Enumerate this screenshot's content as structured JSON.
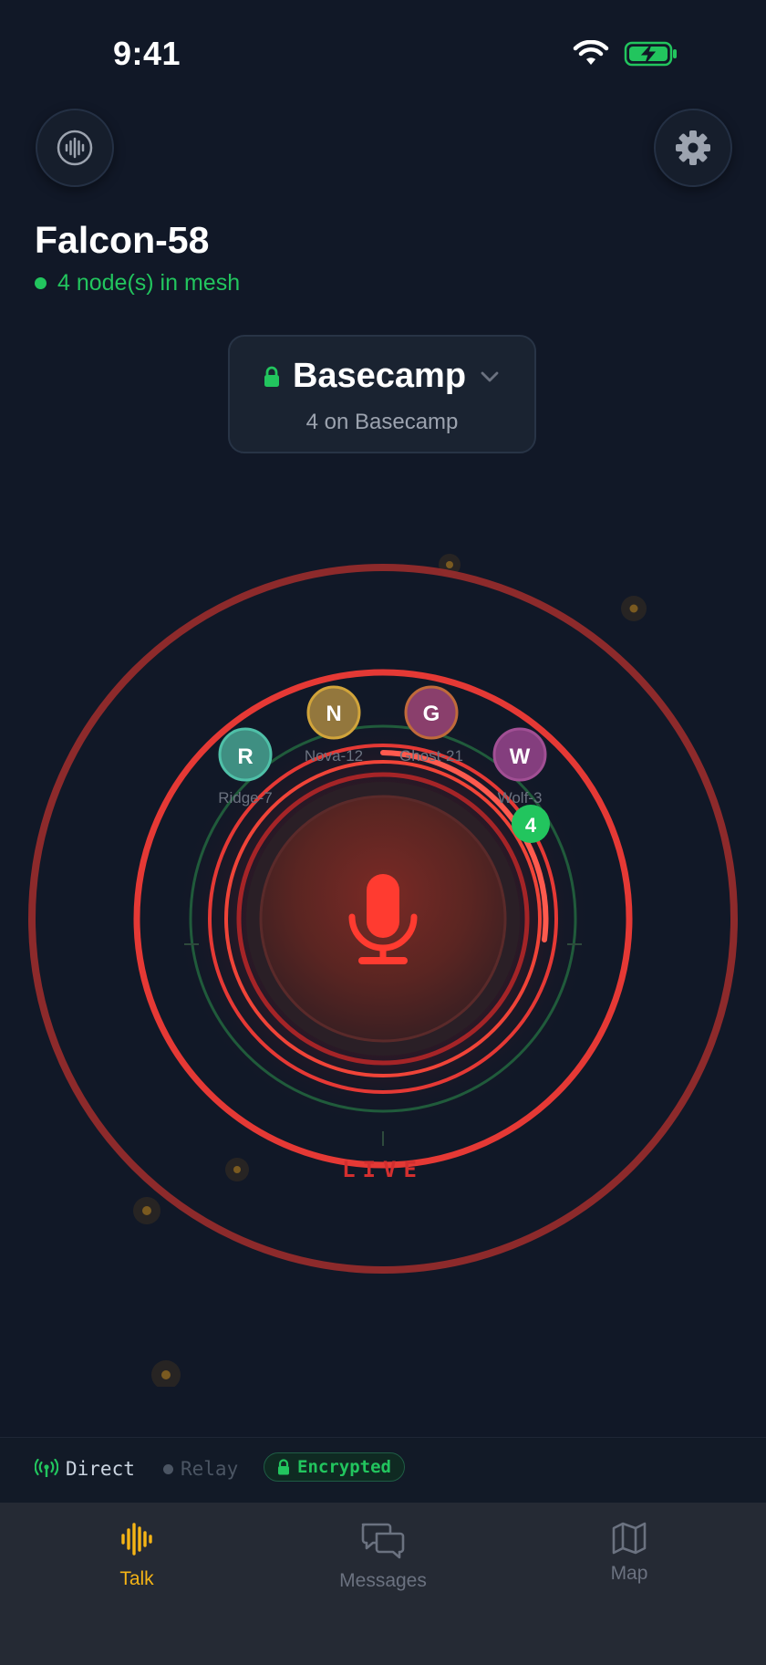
{
  "status_bar": {
    "time": "9:41"
  },
  "header": {
    "node_name": "Falcon-58",
    "mesh_status": "4 node(s) in mesh"
  },
  "channel": {
    "name": "Basecamp",
    "subtitle": "4 on Basecamp"
  },
  "talk_button": {
    "state_label": "LIVE",
    "peer_count_badge": "4",
    "peers": [
      {
        "initial": "R",
        "name": "Ridge-7",
        "color": "#3f9a8a"
      },
      {
        "initial": "N",
        "name": "Nova-12",
        "color": "#9b7a3a"
      },
      {
        "initial": "G",
        "name": "Ghost-21",
        "color": "#8f3f6f"
      },
      {
        "initial": "W",
        "name": "Wolf-3",
        "color": "#8a3f80"
      }
    ]
  },
  "link_modes": {
    "direct_label": "Direct",
    "relay_label": "Relay",
    "encryption_label": "Encrypted"
  },
  "tab_bar": {
    "tabs": [
      {
        "label": "Talk",
        "icon": "waveform-icon",
        "active": true
      },
      {
        "label": "Messages",
        "icon": "chat-bubbles-icon",
        "active": false
      },
      {
        "label": "Map",
        "icon": "map-icon",
        "active": false
      }
    ]
  },
  "colors": {
    "background": "#111827",
    "accent_green": "#22c55e",
    "live_red": "#ef4444",
    "active_tab": "#f5b416"
  }
}
